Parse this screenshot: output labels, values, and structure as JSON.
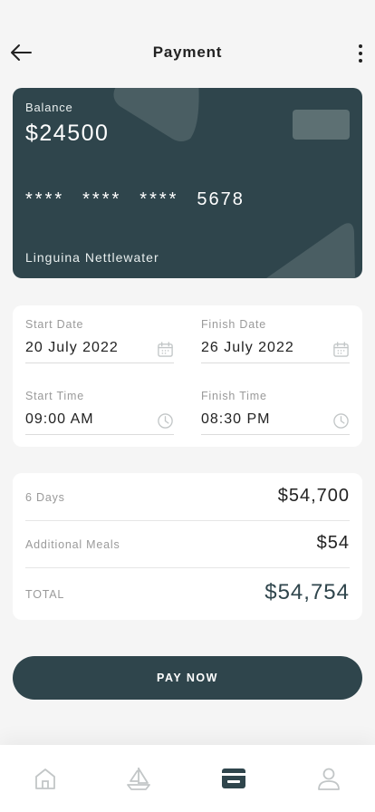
{
  "header": {
    "title": "Payment"
  },
  "card": {
    "balance_label": "Balance",
    "balance": "$24500",
    "number_masked": [
      "****",
      "****",
      "****"
    ],
    "number_last4": "5678",
    "holder": "Linguina Nettlewater"
  },
  "booking": {
    "start_date_label": "Start Date",
    "start_date": "20 July 2022",
    "finish_date_label": "Finish Date",
    "finish_date": "26 July 2022",
    "start_time_label": "Start Time",
    "start_time": "09:00 AM",
    "finish_time_label": "Finish Time",
    "finish_time": "08:30 PM"
  },
  "summary": {
    "days_label": "6 Days",
    "days_amount": "$54,700",
    "meals_label": "Additional Meals",
    "meals_amount": "$54",
    "total_label": "TOTAL",
    "total_amount": "$54,754"
  },
  "pay_button": "PAY NOW",
  "nav": {
    "items": [
      "home-icon",
      "boat-icon",
      "payment-card-icon",
      "profile-icon"
    ],
    "active": "payment-card-icon"
  },
  "colors": {
    "primary": "#2f454c",
    "background": "#f5f5f5",
    "muted": "#9a9a9a",
    "inactive_icon": "#c2c6c7"
  }
}
